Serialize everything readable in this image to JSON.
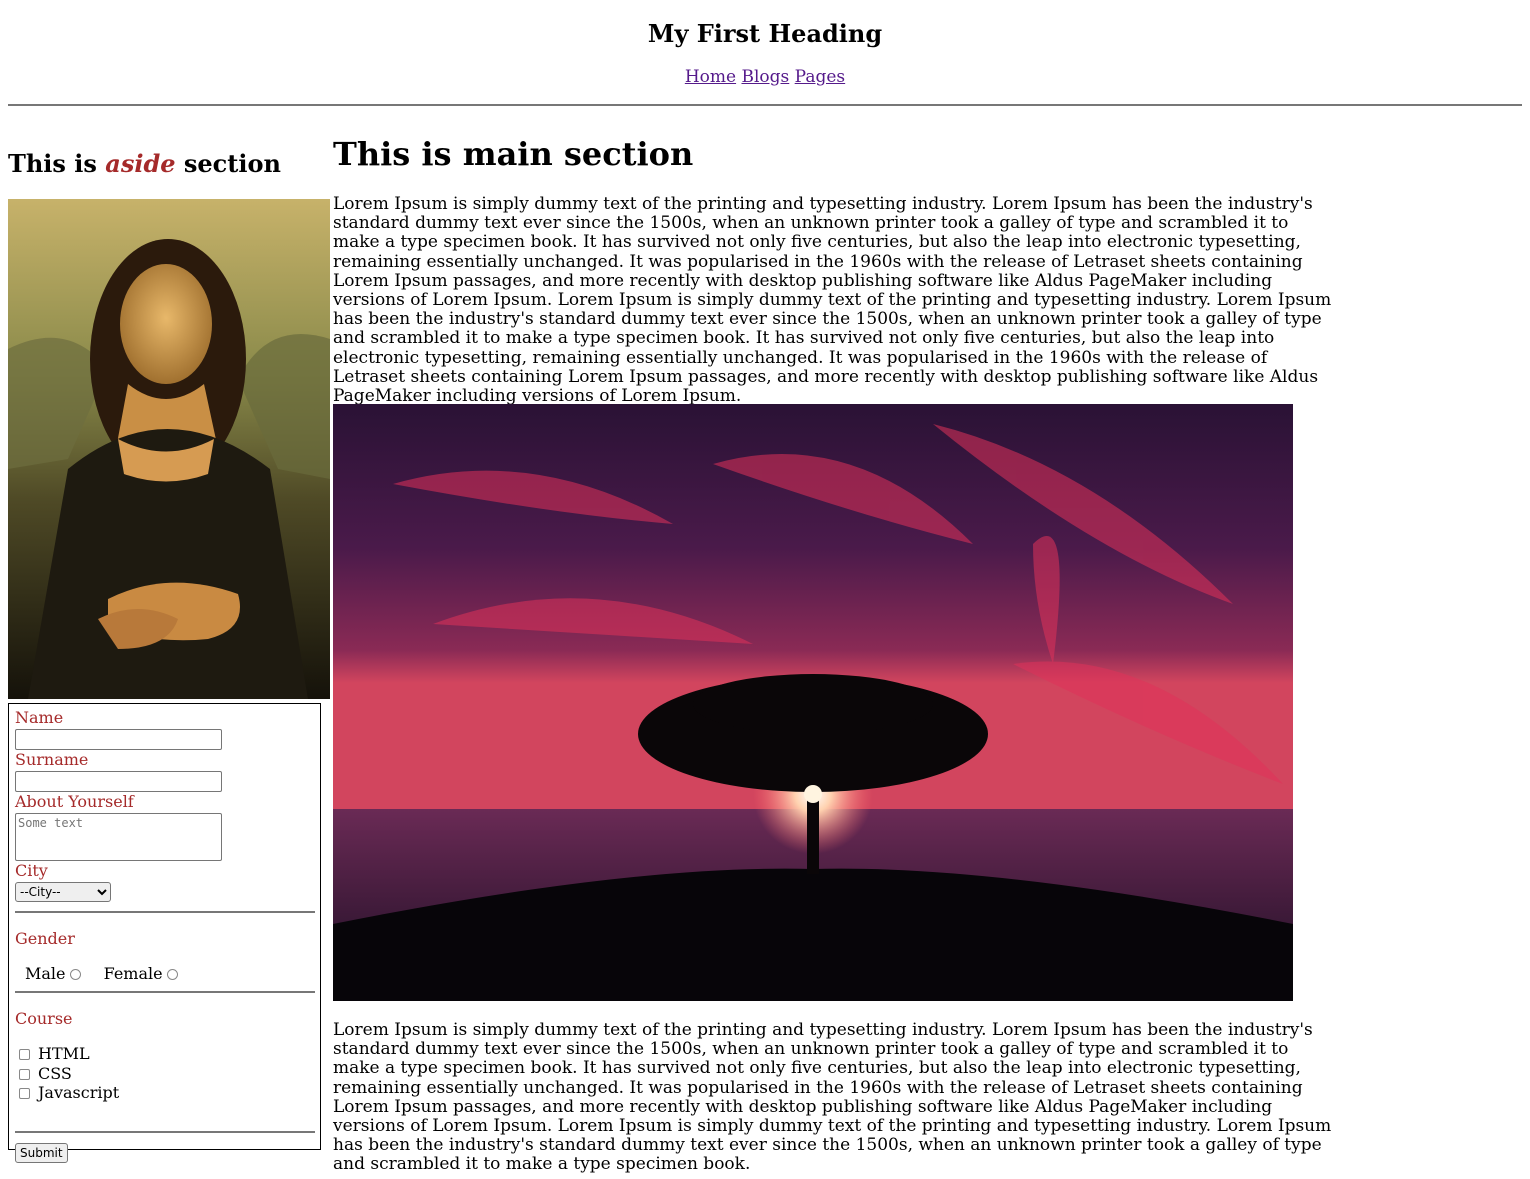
{
  "header": {
    "title": "My First Heading",
    "nav": [
      "Home",
      "Blogs",
      "Pages"
    ]
  },
  "aside": {
    "heading_prefix": "This is ",
    "heading_em": "aside",
    "heading_suffix": " section",
    "image_alt": "Mona Lisa",
    "form": {
      "name_label": "Name",
      "surname_label": "Surname",
      "about_label": "About Yourself",
      "about_placeholder": "Some text",
      "city_label": "City",
      "city_selected": "--City--",
      "gender_label": "Gender",
      "gender_options": [
        "Male",
        "Female"
      ],
      "course_label": "Course",
      "course_options": [
        "HTML",
        "CSS",
        "Javascript"
      ],
      "submit_label": "Submit"
    }
  },
  "main": {
    "heading": "This is main section",
    "paragraph1": "Lorem Ipsum is simply dummy text of the printing and typesetting industry. Lorem Ipsum has been the industry's standard dummy text ever since the 1500s, when an unknown printer took a galley of type and scrambled it to make a type specimen book. It has survived not only five centuries, but also the leap into electronic typesetting, remaining essentially unchanged. It was popularised in the 1960s with the release of Letraset sheets containing Lorem Ipsum passages, and more recently with desktop publishing software like Aldus PageMaker including versions of Lorem Ipsum. Lorem Ipsum is simply dummy text of the printing and typesetting industry. Lorem Ipsum has been the industry's standard dummy text ever since the 1500s, when an unknown printer took a galley of type and scrambled it to make a type specimen book. It has survived not only five centuries, but also the leap into electronic typesetting, remaining essentially unchanged. It was popularised in the 1960s with the release of Letraset sheets containing Lorem Ipsum passages, and more recently with desktop publishing software like Aldus PageMaker including versions of Lorem Ipsum.",
    "image_alt": "Tree at sunset",
    "paragraph2": "Lorem Ipsum is simply dummy text of the printing and typesetting industry. Lorem Ipsum has been the industry's standard dummy text ever since the 1500s, when an unknown printer took a galley of type and scrambled it to make a type specimen book. It has survived not only five centuries, but also the leap into electronic typesetting, remaining essentially unchanged. It was popularised in the 1960s with the release of Letraset sheets containing Lorem Ipsum passages, and more recently with desktop publishing software like Aldus PageMaker including versions of Lorem Ipsum. Lorem Ipsum is simply dummy text of the printing and typesetting industry. Lorem Ipsum has been the industry's standard dummy text ever since the 1500s, when an unknown printer took a galley of type and scrambled it to make a type specimen book."
  },
  "colors": {
    "link": "#551a8b",
    "label": "#a52a2a"
  }
}
